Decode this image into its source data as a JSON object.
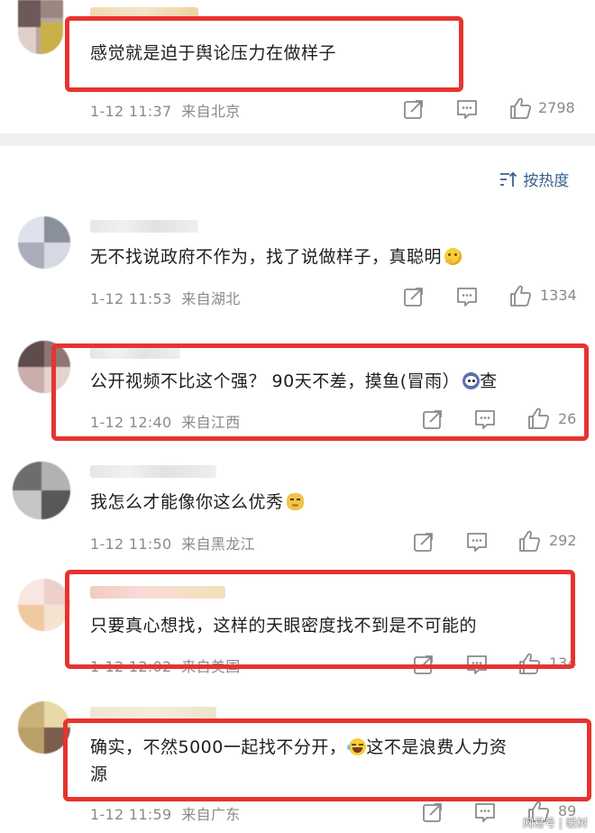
{
  "sort": {
    "icon": "sort-lines-icon",
    "label": "按热度"
  },
  "comments": [
    {
      "text": "感觉就是迫于舆论压力在做样子",
      "emoji": "",
      "time": "1-12 11:37",
      "location": "来自北京",
      "likes": "2798"
    },
    {
      "text": "无不找说政府不作为，找了说做样子，真聪明",
      "emoji": "thinking-emoji",
      "time": "1-12 11:53",
      "location": "来自湖北",
      "likes": "1334"
    },
    {
      "text": "公开视频不比这个强？  90天不差，摸鱼(冒雨）",
      "emoji": "scared-emoji",
      "text_tail": "查",
      "time": "1-12 12:40",
      "location": "来自江西",
      "likes": "26"
    },
    {
      "text": "我怎么才能像你这么优秀",
      "emoji": "doge-emoji",
      "time": "1-12 11:50",
      "location": "来自黑龙江",
      "likes": "292"
    },
    {
      "text": "只要真心想找，这样的天眼密度找不到是不可能的",
      "emoji": "",
      "time": "1-12 12:02",
      "location": "来自美国",
      "likes": "134"
    },
    {
      "text": "确实，不然5000一起找不分开，",
      "emoji": "laugh-cry-emoji",
      "text_tail": "这不是浪费人力资",
      "text_line2": "源",
      "time": "1-12 11:59",
      "location": "来自广东",
      "likes": "89"
    }
  ],
  "watermark": "网易号 | 暖树",
  "colors": {
    "highlight": "#e8332f",
    "meta": "#8a8a8a",
    "link": "#3a5f8f"
  }
}
